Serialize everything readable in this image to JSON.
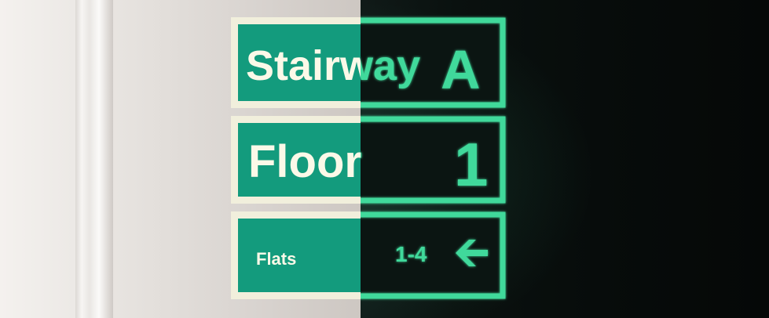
{
  "signs": {
    "stairway": {
      "label": "Stairway",
      "letter": "A"
    },
    "floor": {
      "label": "Floor",
      "number": "1"
    },
    "flats": {
      "label": "Flats",
      "range": "1-4"
    }
  },
  "colors": {
    "sign_green": "#139b7d",
    "sign_border": "#f1f0de",
    "glow_green": "#3fd99b",
    "dark_panel": "#0b1512"
  },
  "icons": {
    "arrow": "arrow-left-icon"
  }
}
